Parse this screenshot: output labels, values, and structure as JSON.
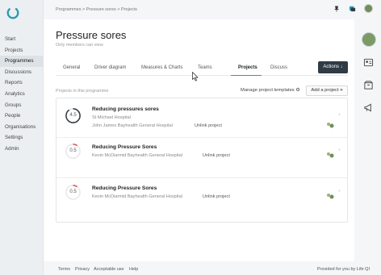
{
  "sidebar": {
    "logo_icon": "lifeqi-ring-icon",
    "items": [
      {
        "label": "Start"
      },
      {
        "label": "Projects"
      },
      {
        "label": "Programmes",
        "active": true
      },
      {
        "label": "Discussions"
      },
      {
        "label": "Reports"
      },
      {
        "label": "Analytics"
      },
      {
        "label": "Groups"
      },
      {
        "label": "People"
      },
      {
        "label": "Organisations"
      },
      {
        "label": "Settings"
      },
      {
        "label": "Admin"
      }
    ]
  },
  "breadcrumb": {
    "items": [
      "Programmes",
      "Pressure sores",
      "Projects"
    ],
    "separator": ">"
  },
  "topbar": {
    "icons": [
      "pin-icon",
      "notifications-icon",
      "user-avatar"
    ]
  },
  "page": {
    "title": "Pressure sores",
    "subtitle": "Only members can view"
  },
  "tabs": [
    {
      "label": "General"
    },
    {
      "label": "Driver diagram"
    },
    {
      "label": "Measures & Charts"
    },
    {
      "label": "Teams"
    },
    {
      "label": "Projects",
      "active": true
    },
    {
      "label": "Discuss"
    }
  ],
  "actions_button": {
    "label": "Actions",
    "icon": "arrow-down-icon"
  },
  "projects_section": {
    "label": "Projects in this programme",
    "manage_label": "Manage project templates",
    "manage_icon": "gear-icon",
    "add_label": "Add a project",
    "add_icon": "plus-icon"
  },
  "projects": [
    {
      "score": "4.5",
      "progress": 0.9,
      "ring_color": "#2f3b45",
      "title": "Reducing pressures sores",
      "org": "St Michael Hospital",
      "people": "John James Bayhealth General Hospital",
      "unlink": "Unlink project"
    },
    {
      "score": "0.5",
      "progress": 0.1,
      "ring_color": "#d9534f",
      "title": "Reducing Pressure Sores",
      "org": "",
      "people": "Kevin McDiarmid Bayhealth General Hospital",
      "unlink": "Unlink project"
    },
    {
      "score": "0.5",
      "progress": 0.1,
      "ring_color": "#d9534f",
      "title": "Reducing Pressure Sores",
      "org": "",
      "people": "Kevin McDiarmid Bayhealth General Hospital",
      "unlink": "Unlink project"
    }
  ],
  "right_rail": {
    "icons": [
      "user-avatar",
      "card-icon",
      "box-icon",
      "megaphone-icon"
    ]
  },
  "footer": {
    "links": [
      "Terms",
      "Privacy",
      "Acceptable use",
      "Help"
    ],
    "provided": "Provided for you by Life QI"
  },
  "colors": {
    "accent": "#2c9bb0",
    "dark": "#2f3b45",
    "danger": "#d9534f"
  }
}
